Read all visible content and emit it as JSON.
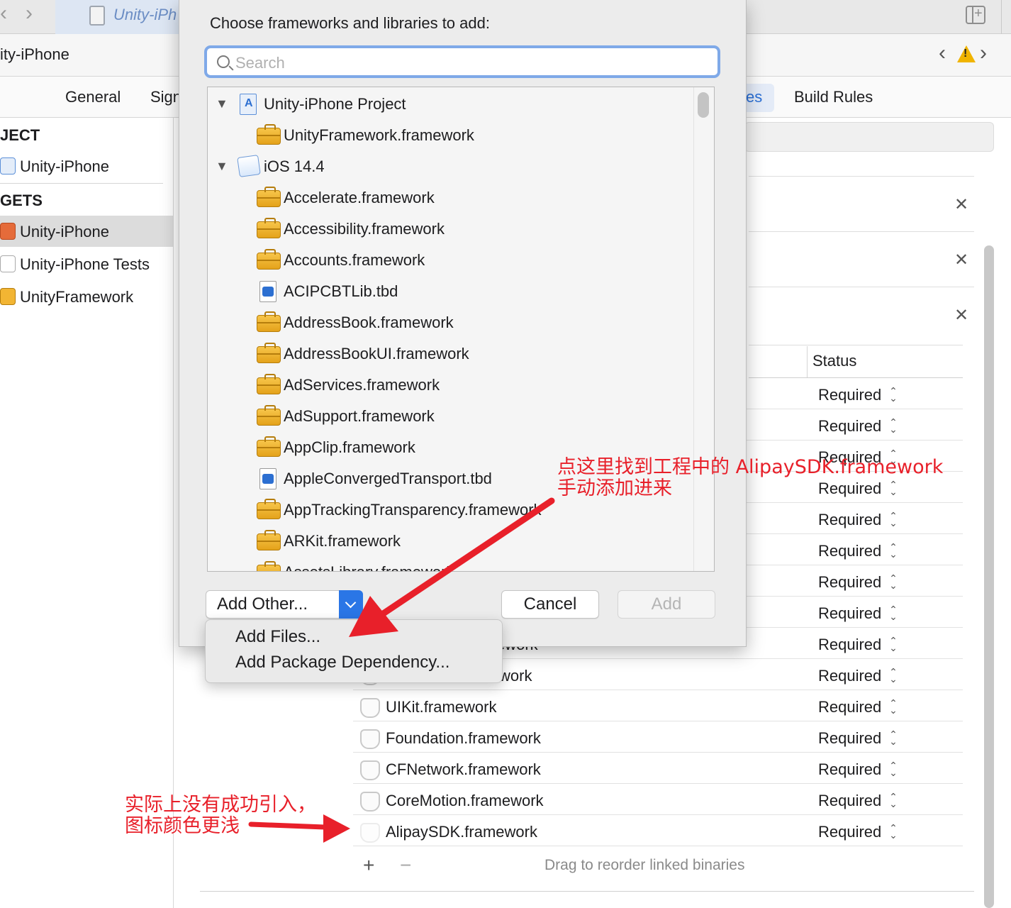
{
  "window": {
    "file_tab_label": "Unity-iPh",
    "jump_title": "ity-iPhone"
  },
  "settings_tabs": {
    "general": "General",
    "signing": "Sign",
    "phases": "es",
    "build_rules": "Build Rules"
  },
  "sidebar": {
    "project_header": "JECT",
    "project_item": "Unity-iPhone",
    "targets_header": "GETS",
    "targets": [
      "Unity-iPhone",
      "Unity-iPhone Tests",
      "UnityFramework"
    ]
  },
  "status_header": "Status",
  "status_rows": [
    "Required",
    "Required",
    "Required",
    "Required",
    "Required",
    "Required",
    "Required",
    "Required",
    "Required",
    "Required",
    "Required",
    "Required",
    "Required",
    "Required",
    "Required"
  ],
  "linked_libraries": {
    "partial_1": "ework",
    "partial_2": "work",
    "items": [
      "UIKit.framework",
      "Foundation.framework",
      "CFNetwork.framework",
      "CoreMotion.framework",
      "AlipaySDK.framework"
    ]
  },
  "drag_hint": "Drag to reorder linked binaries",
  "sheet": {
    "title": "Choose frameworks and libraries to add:",
    "search_placeholder": "Search",
    "groups": [
      {
        "label": "Unity-iPhone Project",
        "items": [
          "UnityFramework.framework"
        ]
      },
      {
        "label": "iOS 14.4",
        "items": [
          "Accelerate.framework",
          "Accessibility.framework",
          "Accounts.framework",
          "ACIPCBTLib.tbd",
          "AddressBook.framework",
          "AddressBookUI.framework",
          "AdServices.framework",
          "AdSupport.framework",
          "AppClip.framework",
          "AppleConvergedTransport.tbd",
          "AppTrackingTransparency.framework",
          "ARKit.framework",
          "AssetsLibrary.framework"
        ]
      }
    ],
    "add_other_label": "Add Other...",
    "cancel_label": "Cancel",
    "add_label": "Add",
    "menu": [
      "Add Files...",
      "Add Package Dependency..."
    ]
  },
  "annotations": {
    "top_line1": "点这里找到工程中的 AlipaySDK.framework",
    "top_line2": "手动添加进来",
    "bottom_line1": "实际上没有成功引入，",
    "bottom_line2": "图标颜色更浅"
  },
  "colors": {
    "accent": "#2a76e6",
    "annotation": "#e8202a",
    "toolbox": "#f2b533"
  }
}
